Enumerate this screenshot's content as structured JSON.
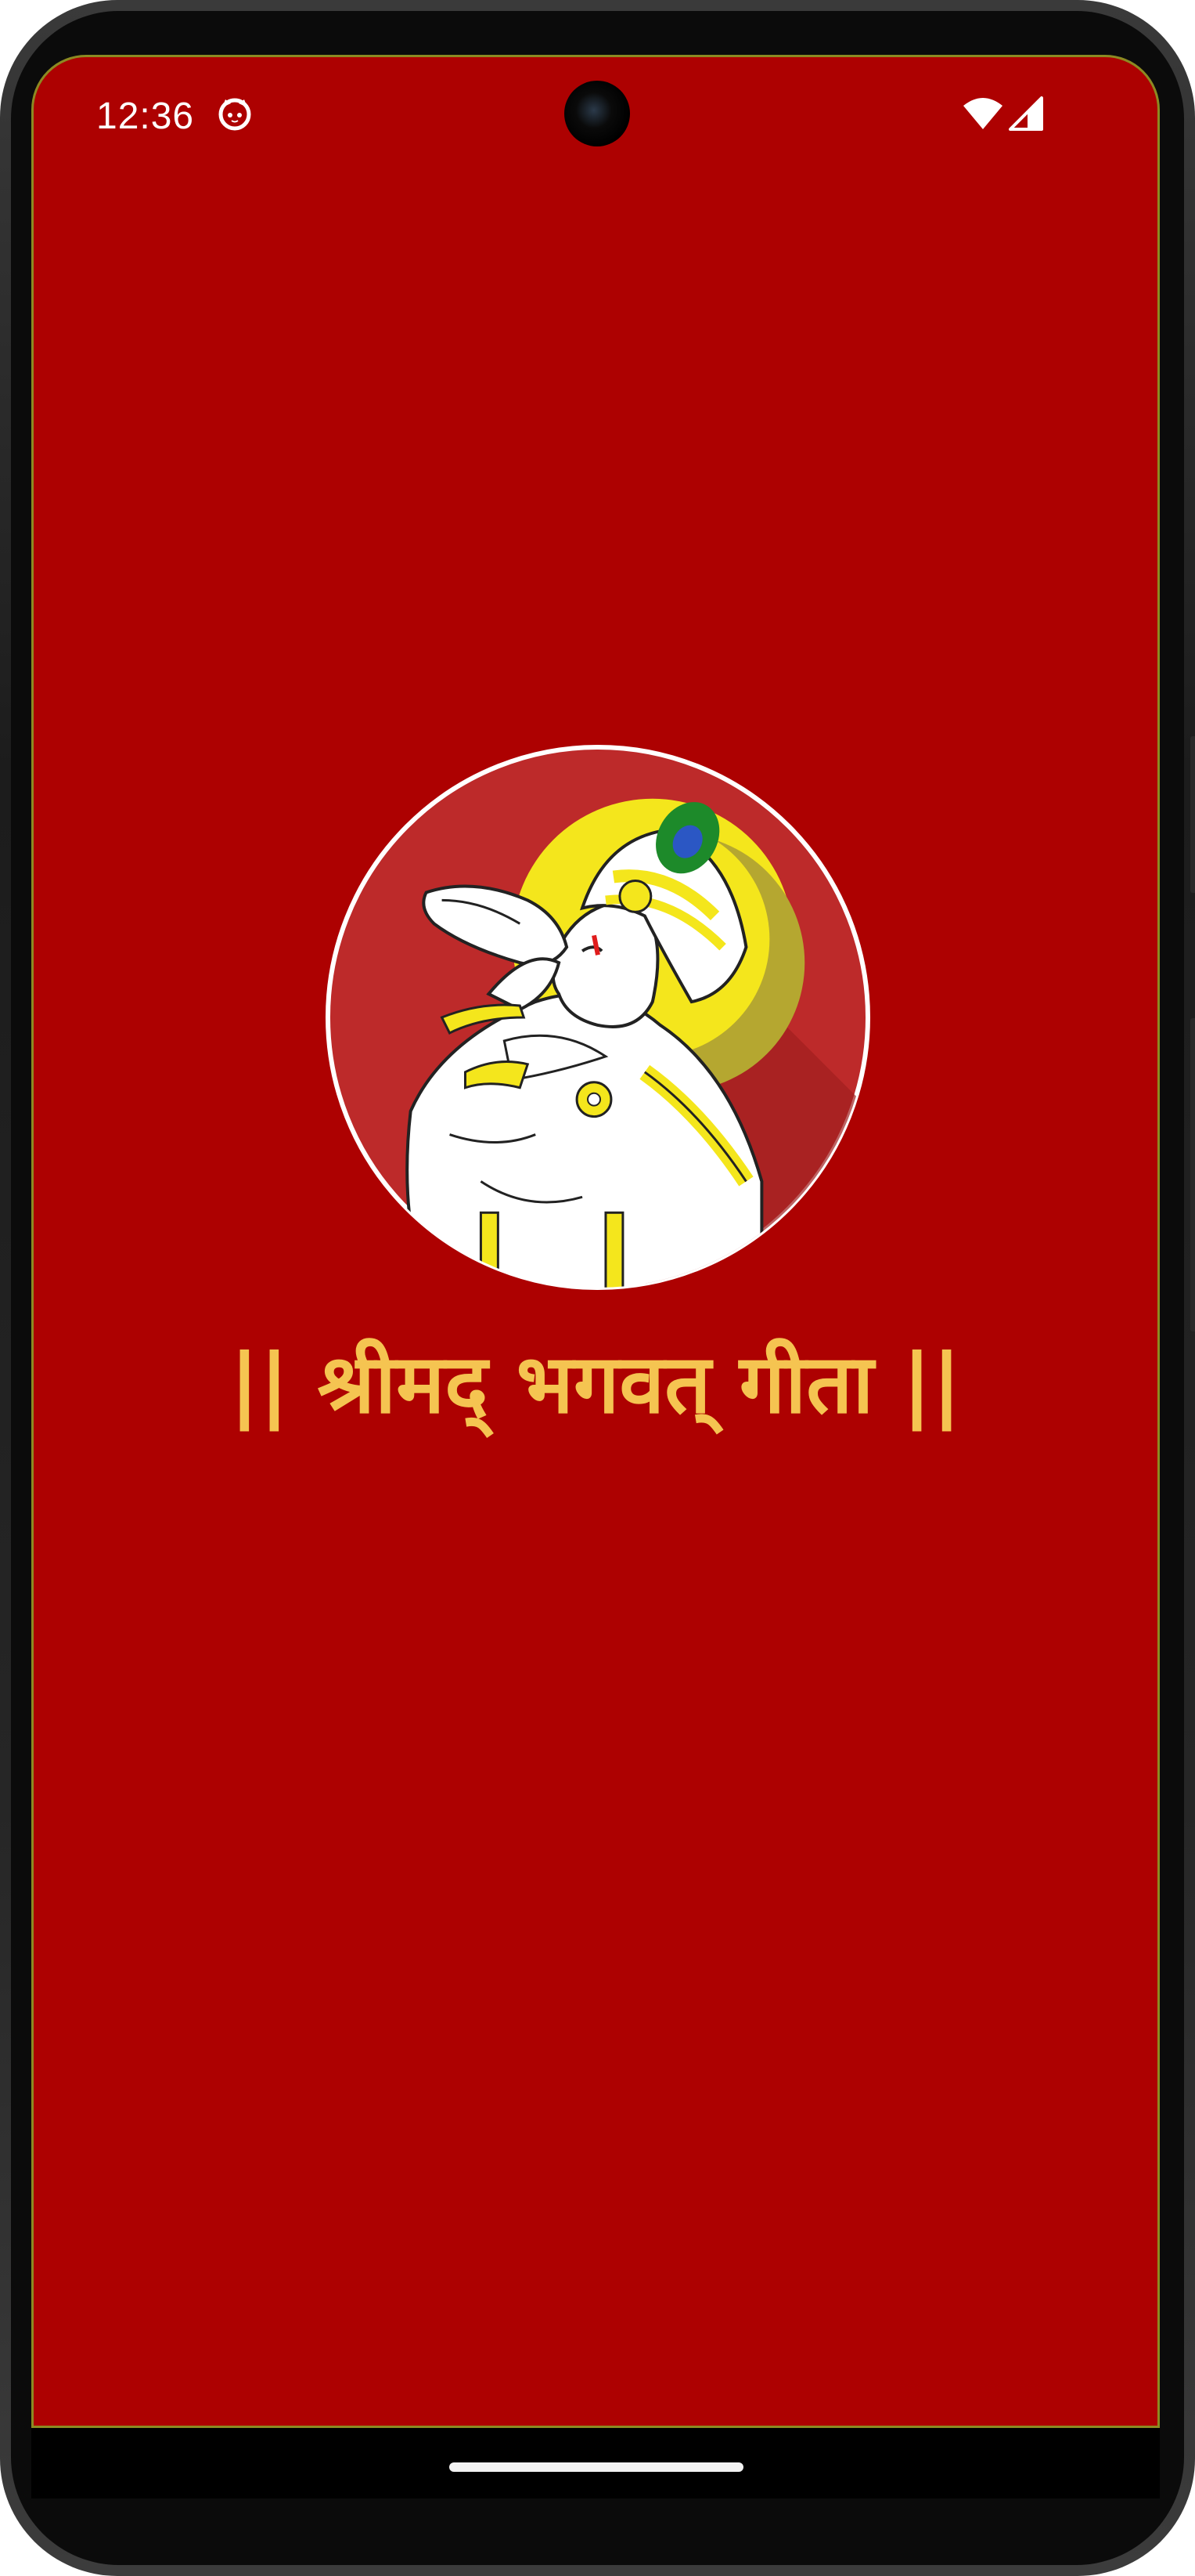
{
  "status_bar": {
    "time": "12:36",
    "app_icon": "cat-face-icon",
    "wifi_icon": "wifi-icon",
    "signal_icon": "cell-signal-icon"
  },
  "splash": {
    "logo_icon": "krishna-blowing-conch-logo",
    "title": "|| श्रीमद् भगवत् गीता  ||"
  },
  "colors": {
    "background": "#ad0101",
    "title": "#f5c451",
    "logo_circle": "#bd2a2a",
    "halo": "#f4e61c"
  }
}
